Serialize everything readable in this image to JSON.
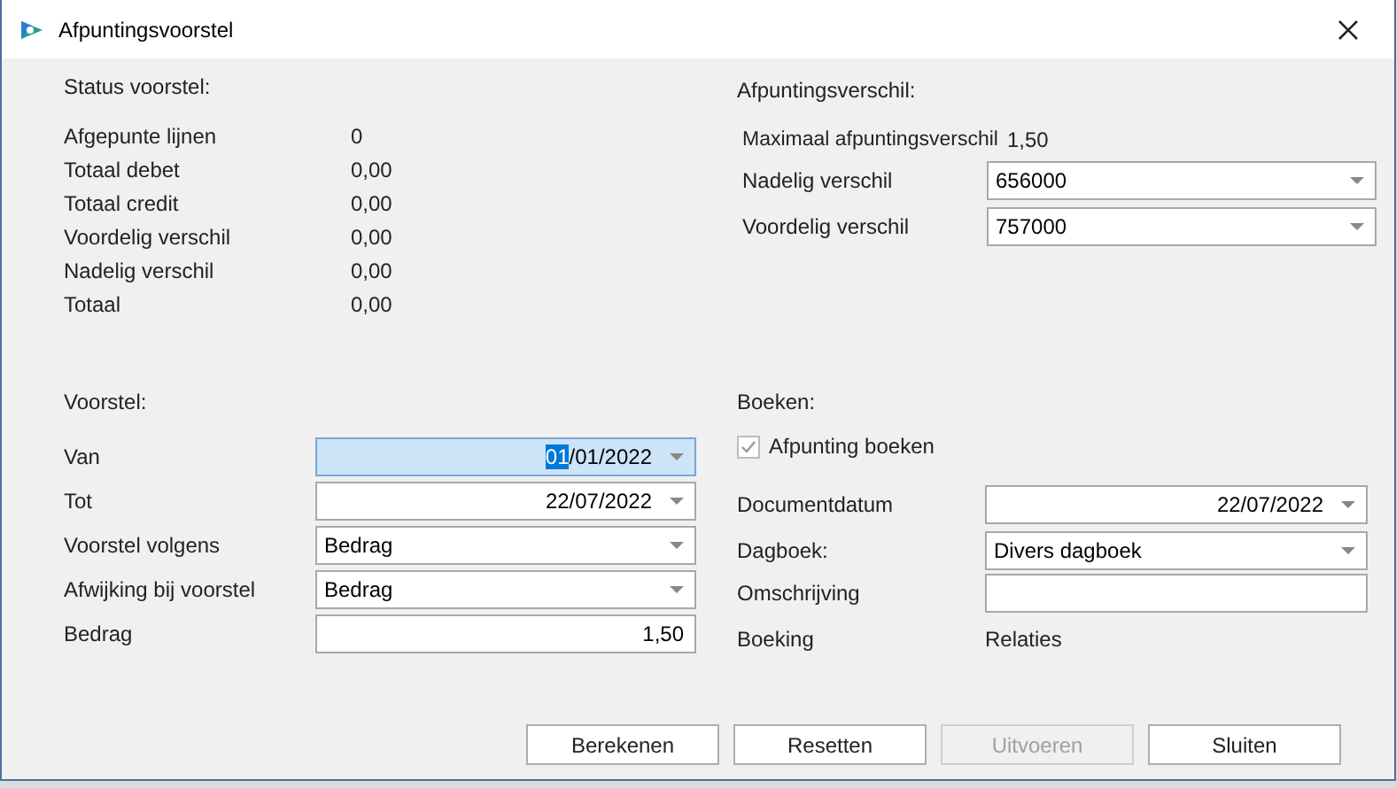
{
  "window": {
    "title": "Afpuntingsvoorstel"
  },
  "status": {
    "heading": "Status voorstel:",
    "rows": [
      {
        "label": "Afgepunte lijnen",
        "value": "0"
      },
      {
        "label": "Totaal debet",
        "value": "0,00"
      },
      {
        "label": "Totaal credit",
        "value": "0,00"
      },
      {
        "label": "Voordelig verschil",
        "value": "0,00"
      },
      {
        "label": "Nadelig verschil",
        "value": "0,00"
      },
      {
        "label": "Totaal",
        "value": "0,00"
      }
    ]
  },
  "difference": {
    "heading": "Afpuntingsverschil:",
    "maximum": {
      "label": "Maximaal afpuntingsverschil",
      "value": "1,50"
    },
    "fields": [
      {
        "label": "Nadelig verschil",
        "kind": "combo",
        "value": "656000"
      },
      {
        "label": "Voordelig verschil",
        "kind": "combo",
        "value": "757000"
      }
    ]
  },
  "proposal": {
    "heading": "Voorstel:",
    "fields": [
      {
        "label": "Van",
        "kind": "date",
        "value": "01/01/2022",
        "focused": true
      },
      {
        "label": "Tot",
        "kind": "date",
        "value": "22/07/2022",
        "focused": false
      },
      {
        "label": "Voorstel volgens",
        "kind": "combo",
        "value": "Bedrag",
        "focused": false
      },
      {
        "label": "Afwijking bij voorstel",
        "kind": "combo",
        "value": "Bedrag",
        "focused": false
      },
      {
        "label": "Bedrag",
        "kind": "number",
        "value": "1,50",
        "focused": false
      }
    ]
  },
  "booking": {
    "heading": "Boeken:",
    "checkbox": {
      "label": "Afpunting boeken",
      "checked": true,
      "disabled": true
    },
    "fields": [
      {
        "label": "Documentdatum",
        "kind": "date",
        "value": "22/07/2022"
      },
      {
        "label": "Dagboek:",
        "kind": "combo",
        "value": "Divers dagboek"
      },
      {
        "label": "Omschrijving",
        "kind": "text"
      }
    ],
    "booking_row": {
      "label": "Boeking",
      "value": "Relaties"
    }
  },
  "buttons": [
    {
      "label": "Berekenen",
      "disabled": false
    },
    {
      "label": "Resetten",
      "disabled": false
    },
    {
      "label": "Uitvoeren",
      "disabled": true
    },
    {
      "label": "Sluiten",
      "disabled": false
    }
  ]
}
